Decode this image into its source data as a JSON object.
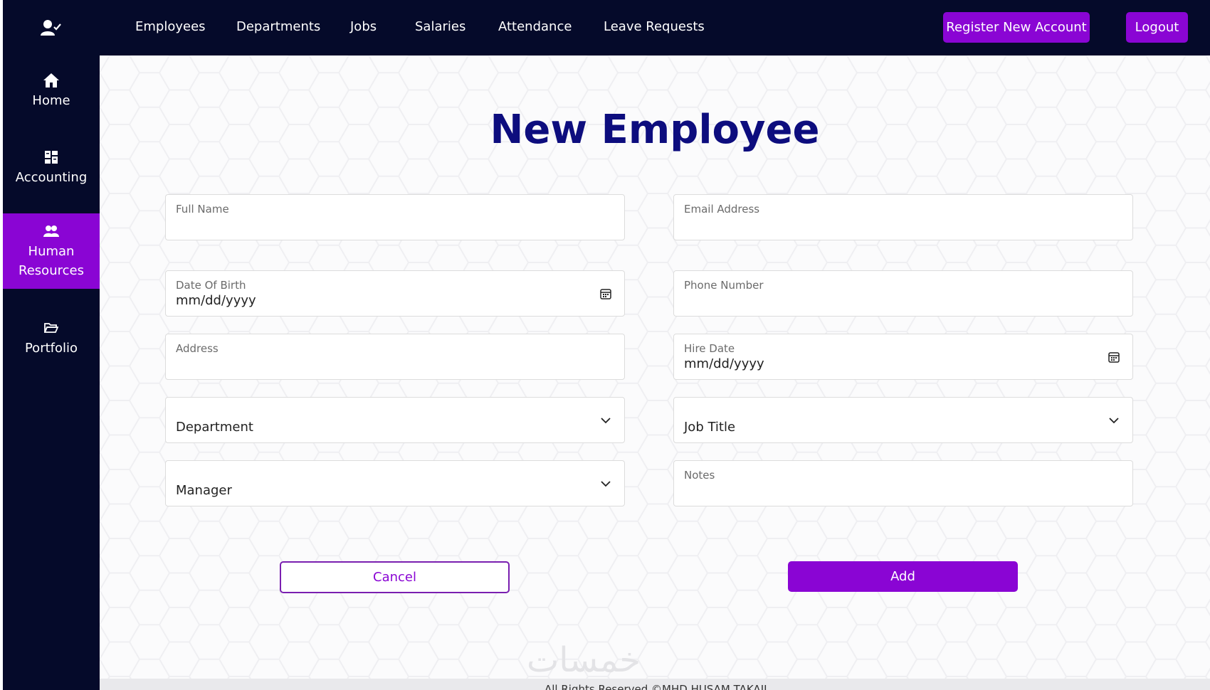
{
  "nav": {
    "links": [
      "Employees",
      "Departments",
      "Jobs",
      "Salaries",
      "Attendance",
      "Leave Requests"
    ],
    "register_label": "Register New Account",
    "logout_label": "Logout"
  },
  "sidebar": {
    "items": [
      {
        "label": "Home",
        "icon": "home-icon"
      },
      {
        "label": "Accounting",
        "icon": "dashboard-icon"
      },
      {
        "label": "Human Resources",
        "icon": "people-icon",
        "active": true
      },
      {
        "label": "Portfolio",
        "icon": "folder-icon"
      }
    ]
  },
  "page": {
    "title": "New Employee"
  },
  "form": {
    "full_name": {
      "label": "Full Name",
      "value": ""
    },
    "email": {
      "label": "Email Address",
      "value": ""
    },
    "dob": {
      "label": "Date Of Birth",
      "value": "mm/dd/yyyy"
    },
    "phone": {
      "label": "Phone Number",
      "value": ""
    },
    "address": {
      "label": "Address",
      "value": ""
    },
    "hire_date": {
      "label": "Hire Date",
      "value": "mm/dd/yyyy"
    },
    "department": {
      "selected": "Department"
    },
    "job_title": {
      "selected": "Job Title"
    },
    "manager": {
      "selected": "Manager"
    },
    "notes": {
      "label": "Notes",
      "value": ""
    },
    "cancel_label": "Cancel",
    "add_label": "Add"
  },
  "watermark": "خمسات",
  "footer": {
    "text": "All Rights Reserved ©MHD HUSAM TAKAJI"
  },
  "colors": {
    "accent": "#8a05d4",
    "nav_bg": "#050a2a",
    "title": "#0d0d7e"
  }
}
